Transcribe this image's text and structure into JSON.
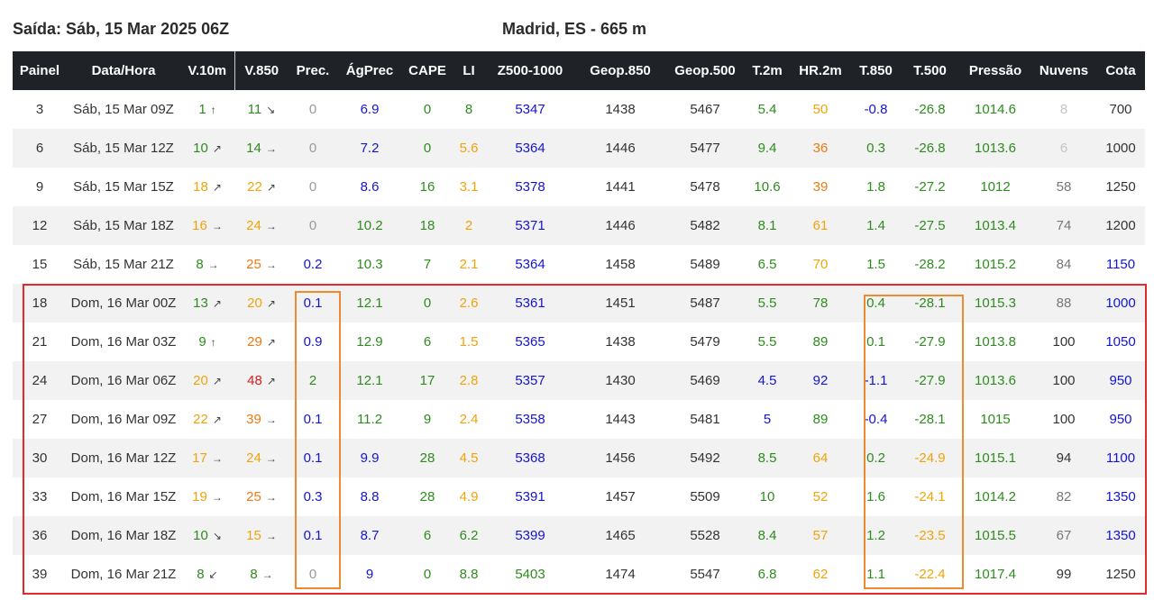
{
  "header": {
    "run": "Saída: Sáb, 15 Mar 2025 06Z",
    "location": "Madrid, ES - 665 m"
  },
  "columns": [
    "Painel",
    "Data/Hora",
    "V.10m",
    "V.850",
    "Prec.",
    "ÁgPrec",
    "CAPE",
    "LI",
    "Z500-1000",
    "Geop.850",
    "Geop.500",
    "T.2m",
    "HR.2m",
    "T.850",
    "T.500",
    "Pressão",
    "Nuvens",
    "Cota"
  ],
  "colors": {
    "green": "#2e8b1e",
    "orange": "#f0a30a",
    "dark_orange": "#ee7a12",
    "red": "#e01c1c",
    "blue": "#1414d4",
    "highlight_red": "#e3292b",
    "highlight_orange": "#f08a2f"
  },
  "rows": [
    {
      "painel": "3",
      "data": "Sáb, 15 Mar 09Z",
      "v10": "1",
      "v10_arrow": "↑",
      "v850": "11",
      "v850_arrow": "↘",
      "prec": "0",
      "agprec": "6.9",
      "cape": "0",
      "li": "8",
      "z500": "5347",
      "geop850": "1438",
      "geop500": "5467",
      "t2m": "5.4",
      "hr": "50",
      "t850": "-0.8",
      "t500": "-26.8",
      "pressao": "1014.6",
      "nuvens": "8",
      "cota": "700"
    },
    {
      "painel": "6",
      "data": "Sáb, 15 Mar 12Z",
      "v10": "10",
      "v10_arrow": "↗",
      "v850": "14",
      "v850_arrow": "→",
      "prec": "0",
      "agprec": "7.2",
      "cape": "0",
      "li": "5.6",
      "z500": "5364",
      "geop850": "1446",
      "geop500": "5477",
      "t2m": "9.4",
      "hr": "36",
      "t850": "0.3",
      "t500": "-26.8",
      "pressao": "1013.6",
      "nuvens": "6",
      "cota": "1000"
    },
    {
      "painel": "9",
      "data": "Sáb, 15 Mar 15Z",
      "v10": "18",
      "v10_arrow": "↗",
      "v850": "22",
      "v850_arrow": "↗",
      "prec": "0",
      "agprec": "8.6",
      "cape": "16",
      "li": "3.1",
      "z500": "5378",
      "geop850": "1441",
      "geop500": "5478",
      "t2m": "10.6",
      "hr": "39",
      "t850": "1.8",
      "t500": "-27.2",
      "pressao": "1012",
      "nuvens": "58",
      "cota": "1250"
    },
    {
      "painel": "12",
      "data": "Sáb, 15 Mar 18Z",
      "v10": "16",
      "v10_arrow": "→",
      "v850": "24",
      "v850_arrow": "→",
      "prec": "0",
      "agprec": "10.2",
      "cape": "18",
      "li": "2",
      "z500": "5371",
      "geop850": "1446",
      "geop500": "5482",
      "t2m": "8.1",
      "hr": "61",
      "t850": "1.4",
      "t500": "-27.5",
      "pressao": "1013.4",
      "nuvens": "74",
      "cota": "1200"
    },
    {
      "painel": "15",
      "data": "Sáb, 15 Mar 21Z",
      "v10": "8",
      "v10_arrow": "→",
      "v850": "25",
      "v850_arrow": "→",
      "prec": "0.2",
      "agprec": "10.3",
      "cape": "7",
      "li": "2.1",
      "z500": "5364",
      "geop850": "1458",
      "geop500": "5489",
      "t2m": "6.5",
      "hr": "70",
      "t850": "1.5",
      "t500": "-28.2",
      "pressao": "1015.2",
      "nuvens": "84",
      "cota": "1150"
    },
    {
      "painel": "18",
      "data": "Dom, 16 Mar 00Z",
      "v10": "13",
      "v10_arrow": "↗",
      "v850": "20",
      "v850_arrow": "↗",
      "prec": "0.1",
      "agprec": "12.1",
      "cape": "0",
      "li": "2.6",
      "z500": "5361",
      "geop850": "1451",
      "geop500": "5487",
      "t2m": "5.5",
      "hr": "78",
      "t850": "0.4",
      "t500": "-28.1",
      "pressao": "1015.3",
      "nuvens": "88",
      "cota": "1000"
    },
    {
      "painel": "21",
      "data": "Dom, 16 Mar 03Z",
      "v10": "9",
      "v10_arrow": "↑",
      "v850": "29",
      "v850_arrow": "↗",
      "prec": "0.9",
      "agprec": "12.9",
      "cape": "6",
      "li": "1.5",
      "z500": "5365",
      "geop850": "1438",
      "geop500": "5479",
      "t2m": "5.5",
      "hr": "89",
      "t850": "0.1",
      "t500": "-27.9",
      "pressao": "1013.8",
      "nuvens": "100",
      "cota": "1050"
    },
    {
      "painel": "24",
      "data": "Dom, 16 Mar 06Z",
      "v10": "20",
      "v10_arrow": "↗",
      "v850": "48",
      "v850_arrow": "↗",
      "prec": "2",
      "agprec": "12.1",
      "cape": "17",
      "li": "2.8",
      "z500": "5357",
      "geop850": "1430",
      "geop500": "5469",
      "t2m": "4.5",
      "hr": "92",
      "t850": "-1.1",
      "t500": "-27.9",
      "pressao": "1013.6",
      "nuvens": "100",
      "cota": "950"
    },
    {
      "painel": "27",
      "data": "Dom, 16 Mar 09Z",
      "v10": "22",
      "v10_arrow": "↗",
      "v850": "39",
      "v850_arrow": "→",
      "prec": "0.1",
      "agprec": "11.2",
      "cape": "9",
      "li": "2.4",
      "z500": "5358",
      "geop850": "1443",
      "geop500": "5481",
      "t2m": "5",
      "hr": "89",
      "t850": "-0.4",
      "t500": "-28.1",
      "pressao": "1015",
      "nuvens": "100",
      "cota": "950"
    },
    {
      "painel": "30",
      "data": "Dom, 16 Mar 12Z",
      "v10": "17",
      "v10_arrow": "→",
      "v850": "24",
      "v850_arrow": "→",
      "prec": "0.1",
      "agprec": "9.9",
      "cape": "28",
      "li": "4.5",
      "z500": "5368",
      "geop850": "1456",
      "geop500": "5492",
      "t2m": "8.5",
      "hr": "64",
      "t850": "0.2",
      "t500": "-24.9",
      "pressao": "1015.1",
      "nuvens": "94",
      "cota": "1100"
    },
    {
      "painel": "33",
      "data": "Dom, 16 Mar 15Z",
      "v10": "19",
      "v10_arrow": "→",
      "v850": "25",
      "v850_arrow": "→",
      "prec": "0.3",
      "agprec": "8.8",
      "cape": "28",
      "li": "4.9",
      "z500": "5391",
      "geop850": "1457",
      "geop500": "5509",
      "t2m": "10",
      "hr": "52",
      "t850": "1.6",
      "t500": "-24.1",
      "pressao": "1014.2",
      "nuvens": "82",
      "cota": "1350"
    },
    {
      "painel": "36",
      "data": "Dom, 16 Mar 18Z",
      "v10": "10",
      "v10_arrow": "↘",
      "v850": "15",
      "v850_arrow": "→",
      "prec": "0.1",
      "agprec": "8.7",
      "cape": "6",
      "li": "6.2",
      "z500": "5399",
      "geop850": "1465",
      "geop500": "5528",
      "t2m": "8.4",
      "hr": "57",
      "t850": "1.2",
      "t500": "-23.5",
      "pressao": "1015.5",
      "nuvens": "67",
      "cota": "1350"
    },
    {
      "painel": "39",
      "data": "Dom, 16 Mar 21Z",
      "v10": "8",
      "v10_arrow": "↙",
      "v850": "8",
      "v850_arrow": "→",
      "prec": "0",
      "agprec": "9",
      "cape": "0",
      "li": "8.8",
      "z500": "5403",
      "geop850": "1474",
      "geop500": "5547",
      "t2m": "6.8",
      "hr": "62",
      "t850": "1.1",
      "t500": "-22.4",
      "pressao": "1017.4",
      "nuvens": "99",
      "cota": "1250"
    }
  ]
}
